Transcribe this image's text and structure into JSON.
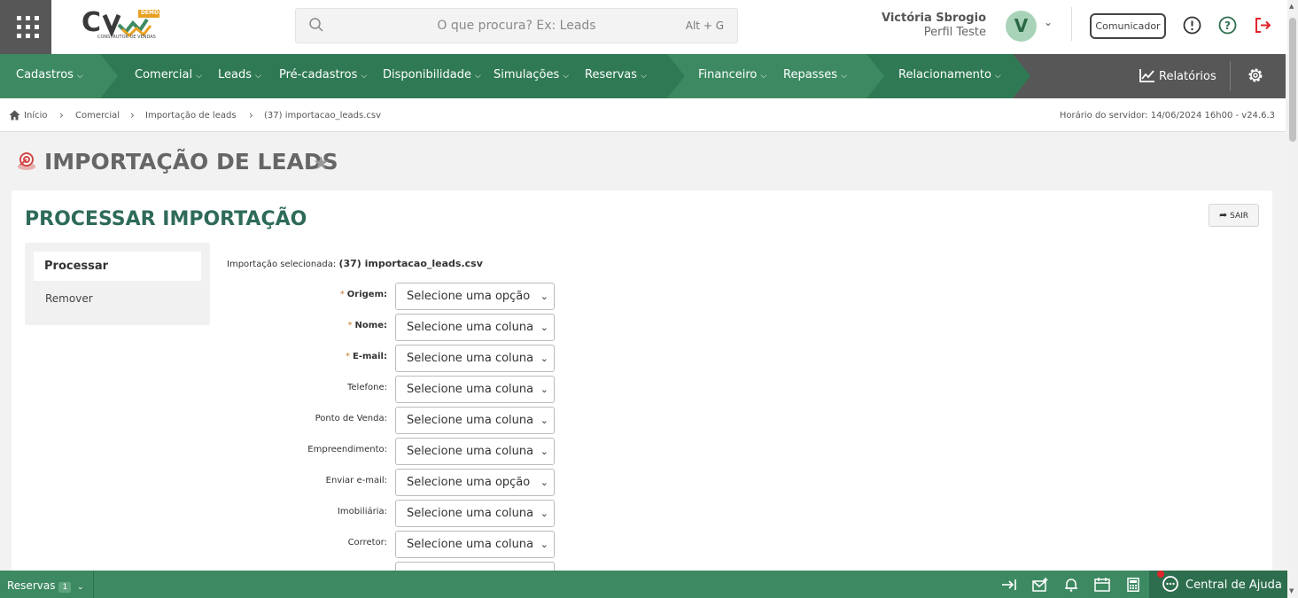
{
  "header": {
    "search_placeholder": "O que procura? Ex: Leads",
    "search_shortcut": "Alt + G",
    "logo_badge": "DEMO",
    "logo_sub": "CONSTRUTOR DE VENDAS",
    "user_name": "Victória Sbrogio",
    "user_role": "Perfil Teste",
    "avatar_letter": "V",
    "comunicador_label": "Comunicador"
  },
  "nav": {
    "items": [
      "Cadastros",
      "Comercial",
      "Leads",
      "Pré-cadastros",
      "Disponibilidade",
      "Simulações",
      "Reservas",
      "Financeiro",
      "Repasses",
      "Relacionamento"
    ],
    "relatorios_label": "Relatórios"
  },
  "breadcrumb": {
    "items": [
      "Início",
      "Comercial",
      "Importação de leads",
      "(37) importacao_leads.csv"
    ],
    "server_time": "Horário do servidor: 14/06/2024 16h00 - v24.6.3"
  },
  "page": {
    "title": "IMPORTAÇÃO DE LEADS"
  },
  "card": {
    "title": "PROCESSAR IMPORTAÇÃO",
    "exit_label": "SAIR",
    "side_menu": [
      "Processar",
      "Remover"
    ],
    "selected_label": "Importação selecionada:",
    "selected_value": "(37) importacao_leads.csv",
    "fields": [
      {
        "label": "Origem:",
        "required": true,
        "value": "Selecione uma opção"
      },
      {
        "label": "Nome:",
        "required": true,
        "value": "Selecione uma coluna"
      },
      {
        "label": "E-mail:",
        "required": true,
        "value": "Selecione uma coluna"
      },
      {
        "label": "Telefone:",
        "required": false,
        "value": "Selecione uma coluna"
      },
      {
        "label": "Ponto de Venda:",
        "required": false,
        "value": "Selecione uma coluna"
      },
      {
        "label": "Empreendimento:",
        "required": false,
        "value": "Selecione uma coluna"
      },
      {
        "label": "Enviar e-mail:",
        "required": false,
        "value": "Selecione uma opção"
      },
      {
        "label": "Imobiliária:",
        "required": false,
        "value": "Selecione uma coluna"
      },
      {
        "label": "Corretor:",
        "required": false,
        "value": "Selecione uma coluna"
      }
    ]
  },
  "footer": {
    "reservas_label": "Reservas",
    "reservas_count": "1",
    "help_label": "Central de Ajuda"
  },
  "colors": {
    "nav_green": "#3d8a62",
    "nav_gray": "#575757",
    "title_teal": "#2e6a5a",
    "logout_red": "#e0242b"
  }
}
